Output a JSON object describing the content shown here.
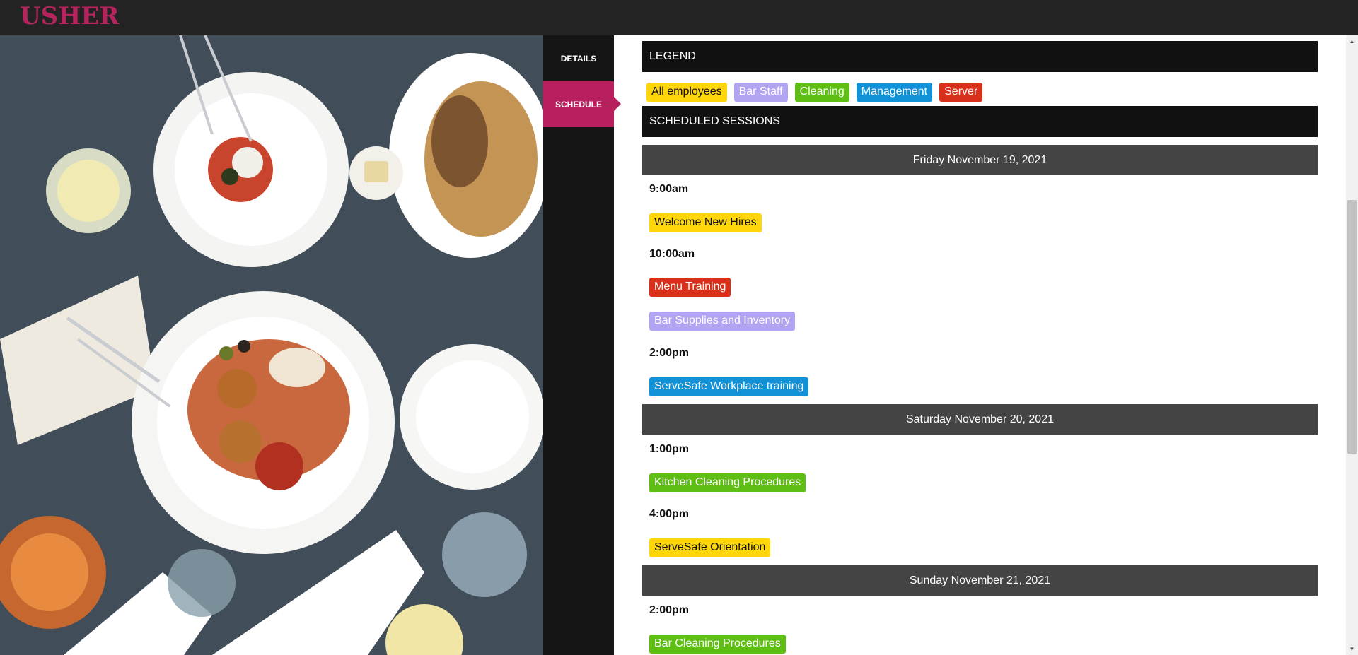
{
  "app": {
    "logo": "USHER"
  },
  "nav": {
    "items": [
      {
        "label": "DETAILS",
        "active": false
      },
      {
        "label": "SCHEDULE",
        "active": true
      }
    ]
  },
  "legend": {
    "title": "LEGEND",
    "items": [
      {
        "label": "All employees",
        "bg": "#ffd60a",
        "fg": "#111111"
      },
      {
        "label": "Bar Staff",
        "bg": "#b3a4f2",
        "fg": "#ffffff"
      },
      {
        "label": "Cleaning",
        "bg": "#5fbe14",
        "fg": "#ffffff"
      },
      {
        "label": "Management",
        "bg": "#1192d8",
        "fg": "#ffffff"
      },
      {
        "label": "Server",
        "bg": "#d9301b",
        "fg": "#ffffff"
      }
    ]
  },
  "schedule": {
    "title": "SCHEDULED SESSIONS",
    "days": [
      {
        "date": "Friday November 19, 2021",
        "slots": [
          {
            "time": "9:00am",
            "sessions": [
              {
                "label": "Welcome New Hires",
                "category": 0
              }
            ]
          },
          {
            "time": "10:00am",
            "sessions": [
              {
                "label": "Menu Training",
                "category": 4
              },
              {
                "label": "Bar Supplies and Inventory",
                "category": 1
              }
            ]
          },
          {
            "time": "2:00pm",
            "sessions": [
              {
                "label": "ServeSafe Workplace training",
                "category": 3
              }
            ]
          }
        ]
      },
      {
        "date": "Saturday November 20, 2021",
        "slots": [
          {
            "time": "1:00pm",
            "sessions": [
              {
                "label": "Kitchen Cleaning Procedures",
                "category": 2
              }
            ]
          },
          {
            "time": "4:00pm",
            "sessions": [
              {
                "label": "ServeSafe Orientation",
                "category": 0
              }
            ]
          }
        ]
      },
      {
        "date": "Sunday November 21, 2021",
        "slots": [
          {
            "time": "2:00pm",
            "sessions": [
              {
                "label": "Bar Cleaning Procedures",
                "category": 2
              }
            ]
          }
        ]
      }
    ]
  }
}
